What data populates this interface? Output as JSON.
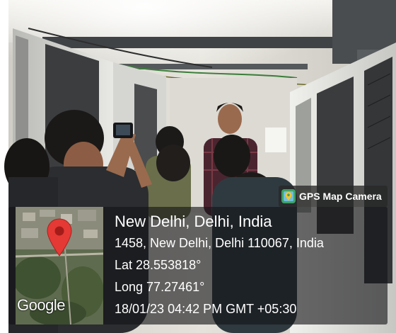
{
  "stamp": {
    "app_label": "GPS Map Camera",
    "map_brand": "Google",
    "location": "New Delhi, Delhi, India",
    "address": "1458, New Delhi, Delhi 110067, India",
    "lat": "Lat 28.553818°",
    "long": "Long 77.27461°",
    "datetime": "18/01/23 04:42 PM GMT +05:30"
  },
  "colors": {
    "pin_red": "#e53935",
    "overlay": "#141416",
    "cabinet": "#e9e9e6"
  },
  "icons": [
    "map-pin-icon",
    "camera-app-icon"
  ]
}
